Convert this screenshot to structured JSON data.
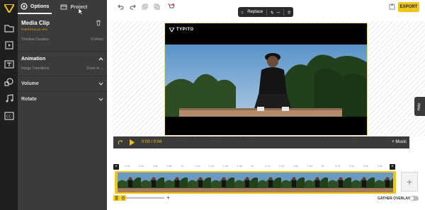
{
  "panel": {
    "tabs": [
      {
        "label": "Options",
        "icon": "options-icon",
        "active": true
      },
      {
        "label": "Project",
        "icon": "project-icon",
        "active": false
      }
    ],
    "clip_title": "Media Clip",
    "clip_file": "PORTFOLIO2.JPG",
    "duration_label": "Timeline Duration",
    "duration_value": "0.04min",
    "sections": [
      {
        "label": "Animation",
        "open": true
      },
      {
        "label": "Volume",
        "open": false
      },
      {
        "label": "Rotate",
        "open": false
      }
    ],
    "image_transitions_label": "Image Transitions",
    "image_transitions_value": "Zoom In"
  },
  "toolbar": {
    "export_label": "EXPORT",
    "accent": "#f0c419"
  },
  "context_menu": {
    "replace_label": "Replace"
  },
  "frame": {
    "brand": "TYPITO"
  },
  "playbar": {
    "current_time": "0:00",
    "separator": "/",
    "total_time": "0:04",
    "music_label": "+ Music"
  },
  "help_label": "Help",
  "timeline": {
    "ticks": [
      "0.2s",
      "0.4s",
      "0.6s",
      "0.8s",
      "1s",
      "1.2s",
      "1.4s",
      "1.6s",
      "1.8s",
      "2s",
      "2.2s",
      "2.4s",
      "2.6s",
      "2.8s",
      "3s",
      "3.2s",
      "3.4s",
      "3.6s",
      "3.8s",
      "4s"
    ],
    "gather_label": "GATHER OVERLAYS",
    "add_label": "+",
    "zoom_plus": "+"
  }
}
